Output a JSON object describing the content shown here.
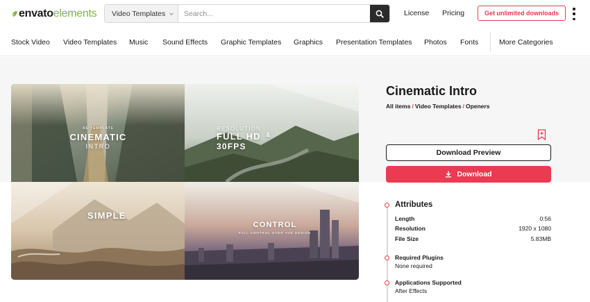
{
  "header": {
    "logo": {
      "part1": "envato",
      "part2": "elements"
    },
    "search": {
      "category": "Video Templates",
      "placeholder": "Search..."
    },
    "links": {
      "license": "License",
      "pricing": "Pricing"
    },
    "cta": "Get unlimited downloads"
  },
  "nav": {
    "items": [
      "Stock Video",
      "Video Templates",
      "Music",
      "Sound Effects",
      "Graphic Templates",
      "Graphics",
      "Presentation Templates",
      "Photos",
      "Fonts"
    ],
    "more": "More Categories"
  },
  "preview": {
    "tile1": {
      "small": "AE TEMPLATE",
      "big": "CINEMATIC",
      "sub": "INTRO"
    },
    "tile2": {
      "line1": "RESOLUTION",
      "line2": "FULL HD",
      "line3": "30FPS",
      "amp": "&"
    },
    "tile3": {
      "big": "SIMPLE"
    },
    "tile4": {
      "big": "CONTROL",
      "small": "FULL CONTROL OVER THE DESIGN"
    }
  },
  "item": {
    "title": "Cinematic Intro",
    "breadcrumb": [
      "All items",
      "Video Templates",
      "Openers"
    ],
    "download_preview": "Download Preview",
    "download": "Download"
  },
  "attributes": {
    "heading": "Attributes",
    "rows": [
      {
        "label": "Length",
        "value": "0:56"
      },
      {
        "label": "Resolution",
        "value": "1920 x 1080"
      },
      {
        "label": "File Size",
        "value": "5.83MB"
      }
    ]
  },
  "plugins": {
    "heading": "Required Plugins",
    "value": "None required"
  },
  "apps": {
    "heading": "Applications Supported",
    "value": "After Effects"
  },
  "colors": {
    "accent": "#e8384f",
    "brand_green": "#82b541",
    "dark": "#191919"
  }
}
